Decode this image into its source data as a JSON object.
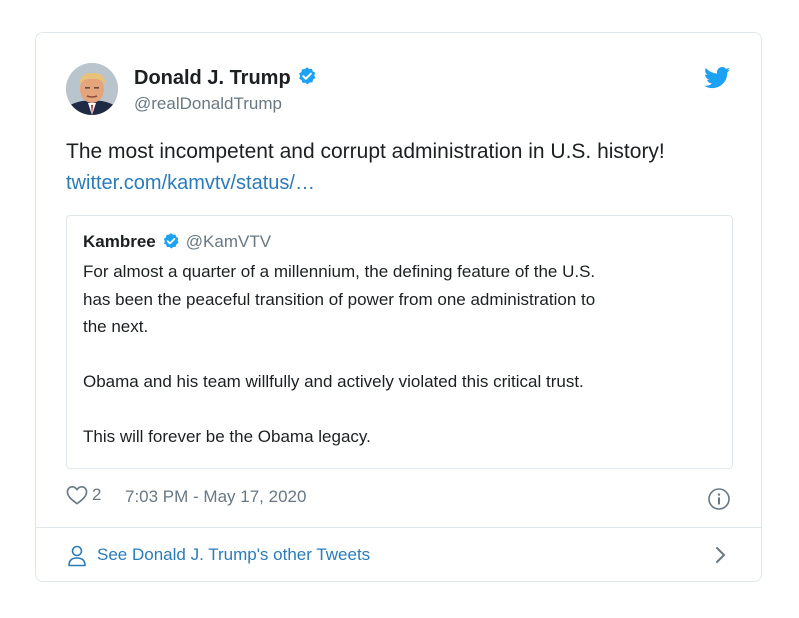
{
  "tweet": {
    "author_name": "Donald J. Trump",
    "author_handle": "@realDonaldTrump",
    "avatar_icon": "profile-photo",
    "verified_icon": "verified-badge-icon",
    "brand_icon": "twitter-bird-icon",
    "text": "The most incompetent and corrupt administration in U.S. history!",
    "link": "twitter.com/kamvtv/status/…",
    "likes": "2",
    "timestamp": "7:03 PM - May 17, 2020"
  },
  "quote": {
    "name": "Kambree",
    "handle": "@KamVTV",
    "paragraphs": [
      [
        "For almost a quarter of a millennium, the defining feature of the U.S.",
        "has been the peaceful transition of power from one administration to",
        "the next."
      ],
      [
        "Obama and his team willfully and actively violated this critical trust."
      ],
      [
        "This will forever be the Obama legacy."
      ]
    ]
  },
  "footer": {
    "label": "See Donald J. Trump's other Tweets"
  },
  "colors": {
    "link": "#2b7bb9",
    "verified": "#1da1f2",
    "muted": "#697882",
    "border": "#e1e8ed",
    "text": "#1c2022"
  }
}
